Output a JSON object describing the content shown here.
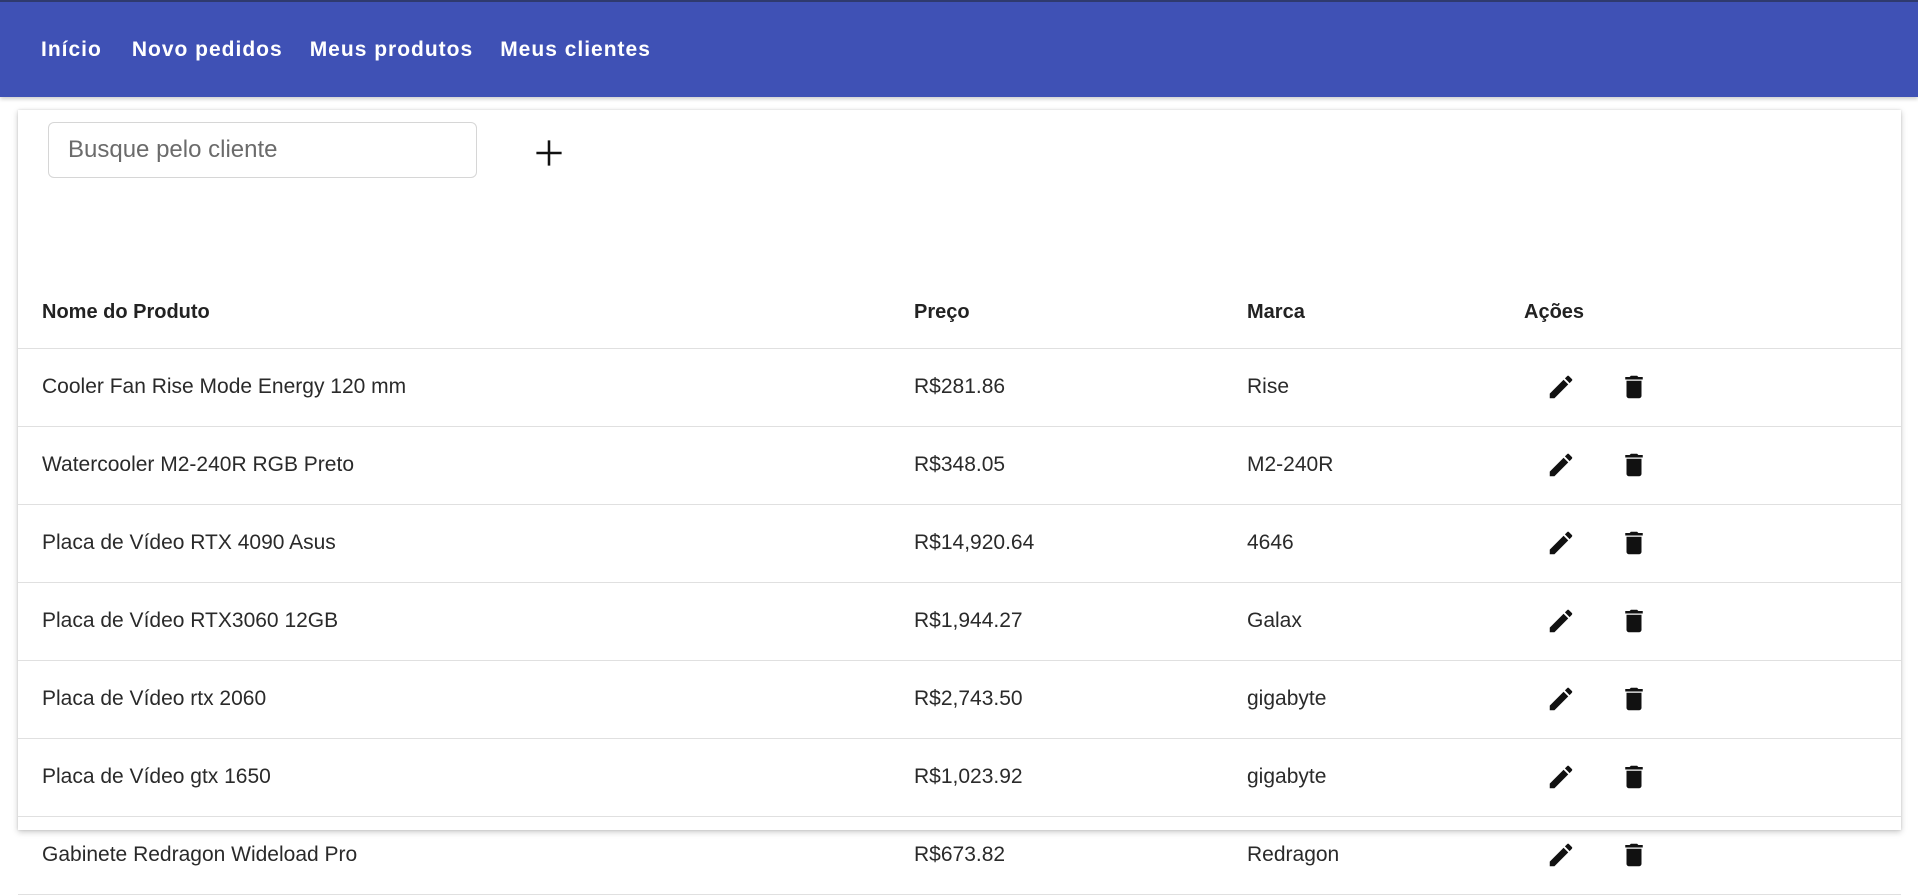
{
  "nav": {
    "items": [
      {
        "label": "Início"
      },
      {
        "label": "Novo pedidos"
      },
      {
        "label": "Meus produtos"
      },
      {
        "label": "Meus clientes"
      }
    ]
  },
  "search": {
    "placeholder": "Busque pelo cliente",
    "value": ""
  },
  "add_button": {
    "icon": "plus-icon"
  },
  "table": {
    "headers": [
      "Nome do Produto",
      "Preço",
      "Marca",
      "Ações"
    ],
    "rows": [
      {
        "name": "Cooler Fan Rise Mode Energy 120 mm",
        "price": "R$281.86",
        "brand": "Rise"
      },
      {
        "name": "Watercooler M2-240R RGB Preto",
        "price": "R$348.05",
        "brand": "M2-240R"
      },
      {
        "name": "Placa de Vídeo RTX 4090 Asus",
        "price": "R$14,920.64",
        "brand": "4646"
      },
      {
        "name": "Placa de Vídeo RTX3060 12GB",
        "price": "R$1,944.27",
        "brand": "Galax"
      },
      {
        "name": "Placa de Vídeo rtx 2060",
        "price": "R$2,743.50",
        "brand": "gigabyte"
      },
      {
        "name": "Placa de Vídeo gtx 1650",
        "price": "R$1,023.92",
        "brand": "gigabyte"
      },
      {
        "name": "Gabinete Redragon Wideload Pro",
        "price": "R$673.82",
        "brand": "Redragon"
      }
    ],
    "row_actions": [
      "pencil-icon",
      "trash-icon"
    ]
  },
  "colors": {
    "topbar": "#3f51b5",
    "nav_text": "#ffffff",
    "icon": "#111111"
  }
}
